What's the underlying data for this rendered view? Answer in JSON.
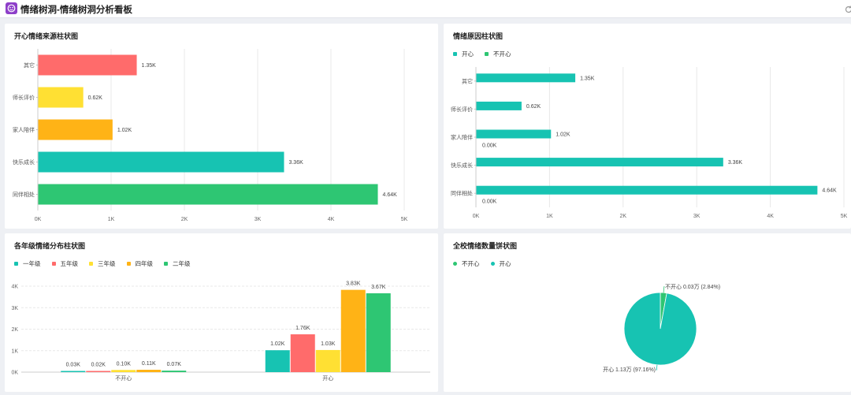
{
  "header": {
    "title": "情绪树洞-情绪树洞分析看板",
    "app_icon": "emotion-face-icon",
    "corner_icon": "refresh-icon"
  },
  "colors": {
    "teal": "#17c3b2",
    "red": "#ff6b6b",
    "yellow": "#ffe033",
    "orange": "#ffb316",
    "green": "#2ec673"
  },
  "panels": {
    "p1": {
      "title": "开心情绪来源柱状图"
    },
    "p2": {
      "title": "情绪原因柱状图",
      "legend": [
        {
          "name": "开心",
          "color": "#17c3b2"
        },
        {
          "name": "不开心",
          "color": "#2ec673"
        }
      ]
    },
    "p3": {
      "title": "各年级情绪分布柱状图",
      "legend": [
        {
          "name": "一年级",
          "color": "#17c3b2"
        },
        {
          "name": "五年级",
          "color": "#ff6b6b"
        },
        {
          "name": "三年级",
          "color": "#ffe033"
        },
        {
          "name": "四年级",
          "color": "#ffb316"
        },
        {
          "name": "二年级",
          "color": "#2ec673"
        }
      ]
    },
    "p4": {
      "title": "全校情绪数量饼状图",
      "legend": [
        {
          "name": "不开心",
          "color": "#2ec673"
        },
        {
          "name": "开心",
          "color": "#17c3b2"
        }
      ]
    }
  },
  "chart_data": [
    {
      "type": "bar",
      "orientation": "horizontal",
      "categories": [
        "其它",
        "师长评价",
        "家人陪伴",
        "快乐成长",
        "同伴相处"
      ],
      "values": [
        1350,
        620,
        1020,
        3360,
        4640
      ],
      "value_labels": [
        "1.35K",
        "0.62K",
        "1.02K",
        "3.36K",
        "4.64K"
      ],
      "bar_colors": [
        "#ff6b6b",
        "#ffe033",
        "#ffb316",
        "#17c3b2",
        "#2ec673"
      ],
      "xticks": [
        "0K",
        "1K",
        "2K",
        "3K",
        "4K",
        "5K"
      ],
      "xlim": [
        0,
        5000
      ],
      "grid": true
    },
    {
      "type": "bar",
      "orientation": "horizontal",
      "categories": [
        "其它",
        "师长评价",
        "家人陪伴",
        "快乐成长",
        "同伴相处"
      ],
      "series": [
        {
          "name": "开心",
          "color": "#17c3b2",
          "values": [
            1350,
            620,
            1020,
            3360,
            4640
          ],
          "labels": [
            "1.35K",
            "0.62K",
            "1.02K",
            "3.36K",
            "4.64K"
          ]
        },
        {
          "name": "不开心",
          "color": "#2ec673",
          "values": [
            null,
            null,
            0,
            null,
            0
          ],
          "labels": [
            "",
            "",
            "0.00K",
            "",
            "0.00K"
          ]
        }
      ],
      "xticks": [
        "0K",
        "1K",
        "2K",
        "3K",
        "4K",
        "5K"
      ],
      "xlim": [
        0,
        5000
      ],
      "grid": true,
      "legend": "top-left"
    },
    {
      "type": "bar",
      "orientation": "vertical",
      "categories": [
        "不开心",
        "开心"
      ],
      "series": [
        {
          "name": "一年级",
          "color": "#17c3b2",
          "values": [
            30,
            1020
          ],
          "labels": [
            "0.03K",
            "1.02K"
          ]
        },
        {
          "name": "五年级",
          "color": "#ff6b6b",
          "values": [
            20,
            1760
          ],
          "labels": [
            "0.02K",
            "1.76K"
          ]
        },
        {
          "name": "三年级",
          "color": "#ffe033",
          "values": [
            100,
            1030
          ],
          "labels": [
            "0.10K",
            "1.03K"
          ]
        },
        {
          "name": "四年级",
          "color": "#ffb316",
          "values": [
            110,
            3830
          ],
          "labels": [
            "0.11K",
            "3.83K"
          ]
        },
        {
          "name": "二年级",
          "color": "#2ec673",
          "values": [
            70,
            3670
          ],
          "labels": [
            "0.07K",
            "3.67K"
          ]
        }
      ],
      "yticks": [
        "0K",
        "1K",
        "2K",
        "3K",
        "4K"
      ],
      "ylim": [
        0,
        4000
      ],
      "grid": true,
      "legend": "top-left"
    },
    {
      "type": "pie",
      "slices": [
        {
          "name": "不开心",
          "value": 0.03,
          "percent": 2.84,
          "color": "#2ec673",
          "label": "不开心  0.03万 (2.84%)"
        },
        {
          "name": "开心",
          "value": 1.13,
          "percent": 97.16,
          "color": "#17c3b2",
          "label": "开心  1.13万 (97.16%)"
        }
      ],
      "legend": "top-left"
    }
  ]
}
